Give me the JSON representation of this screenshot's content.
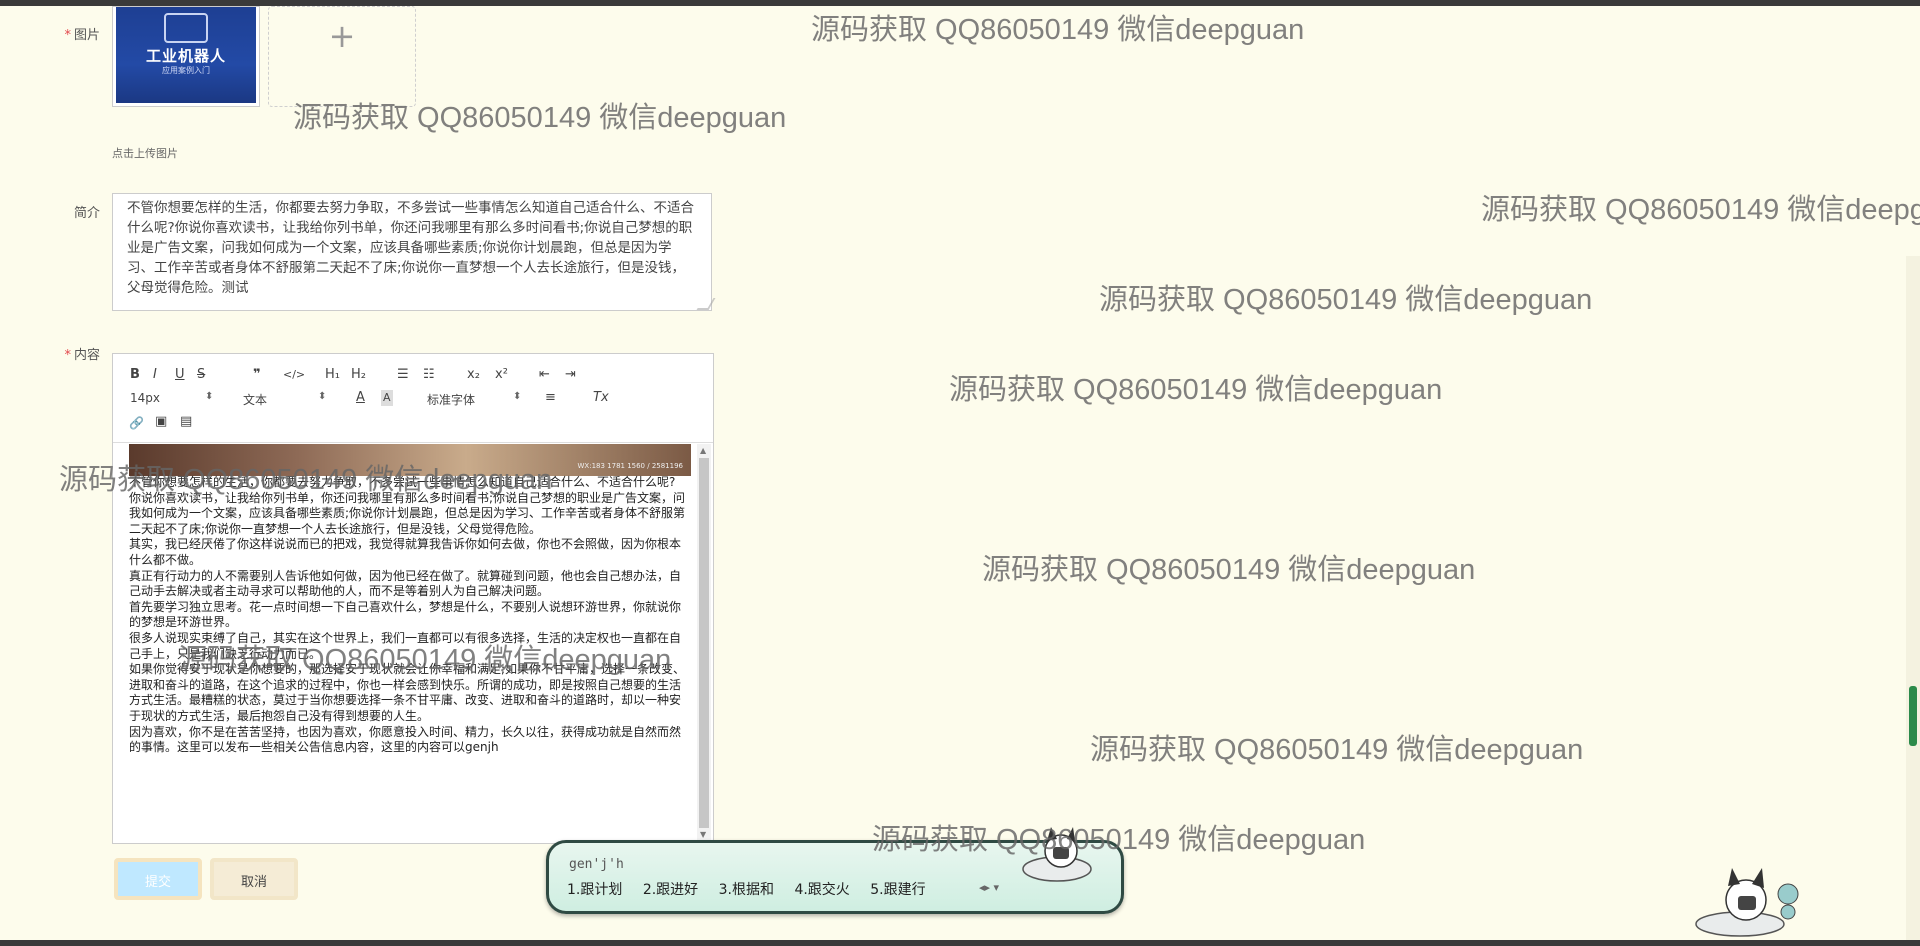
{
  "form": {
    "image_label": "图片",
    "upload_hint": "点击上传图片",
    "upload_plus": "+",
    "book": {
      "title": "工业机器人",
      "subtitle": "应用案例入门"
    },
    "intro_label": "简介",
    "intro_text": "不管你想要怎样的生活，你都要去努力争取，不多尝试一些事情怎么知道自己适合什么、不适合什么呢?你说你喜欢读书，让我给你列书单，你还问我哪里有那么多时间看书;你说自己梦想的职业是广告文案，问我如何成为一个文案，应该具备哪些素质;你说你计划晨跑，但总是因为学习、工作辛苦或者身体不舒服第二天起不了床;你说你一直梦想一个人去长途旅行，但是没钱，父母觉得危险。测试",
    "content_label": "内容",
    "required_mark": "*"
  },
  "toolbar": {
    "bold": "B",
    "italic": "I",
    "underline": "U",
    "strike": "S",
    "quote": "❞",
    "code": "</>",
    "h1": "H₁",
    "h2": "H₂",
    "ordered_list": "☰",
    "bullet_list": "☷",
    "subscript": "x₂",
    "superscript": "x²",
    "outdent": "⇤",
    "indent": "⇥",
    "size_value": "14px",
    "header_value": "文本",
    "font_value": "标准字体",
    "align": "≡",
    "clean": "Tx",
    "link": "🔗",
    "image": "▣",
    "video": "▤",
    "select_arrow": "⬍"
  },
  "editor": {
    "banner_text": "WX:183 1781 1560 / 2581196",
    "paragraphs": [
      "不管你想要怎样的生活，你都要去努力争取，不多尝试一些事情怎么知道自己适合什么、不适合什么呢?",
      "你说你喜欢读书，让我给你列书单，你还问我哪里有那么多时间看书;你说自己梦想的职业是广告文案，问我如何成为一个文案，应该具备哪些素质;你说你计划晨跑，但总是因为学习、工作辛苦或者身体不舒服第二天起不了床;你说你一直梦想一个人去长途旅行，但是没钱，父母觉得危险。",
      "其实，我已经厌倦了你这样说说而已的把戏，我觉得就算我告诉你如何去做，你也不会照做，因为你根本什么都不做。",
      "真正有行动力的人不需要别人告诉他如何做，因为他已经在做了。就算碰到问题，他也会自己想办法，自己动手去解决或者主动寻求可以帮助他的人，而不是等着别人为自己解决问题。",
      "首先要学习独立思考。花一点时间想一下自己喜欢什么，梦想是什么，不要别人说想环游世界，你就说你的梦想是环游世界。",
      "很多人说现实束缚了自己，其实在这个世界上，我们一直都可以有很多选择，生活的决定权也一直都在自己手上，只是我们缺乏行动力而已。",
      "如果你觉得安于现状是你想要的，那选择安于现状就会让你幸福和满足;如果你不甘平庸，选择一条改变、进取和奋斗的道路，在这个追求的过程中，你也一样会感到快乐。所谓的成功，即是按照自己想要的生活方式生活。最糟糕的状态，莫过于当你想要选择一条不甘平庸、改变、进取和奋斗的道路时，却以一种安于现状的方式生活，最后抱怨自己没有得到想要的人生。",
      "因为喜欢，你不是在苦苦坚持，也因为喜欢，你愿意投入时间、精力，长久以往，获得成功就是自然而然的事情。这里可以发布一些相关公告信息内容，这里的内容可以genjh"
    ]
  },
  "buttons": {
    "submit": "提交",
    "cancel": "取消"
  },
  "ime": {
    "composition": "gen'j'h",
    "candidates": [
      "1.跟计划",
      "2.跟进好",
      "3.根据和",
      "4.跟交火",
      "5.跟建行"
    ],
    "nav": "◂▸ ▾"
  },
  "watermark": "源码获取 QQ86050149 微信deepguan",
  "colors": {
    "background": "#fdfcec",
    "required": "#e3464b",
    "submit_bg": "#bfe8ff"
  }
}
